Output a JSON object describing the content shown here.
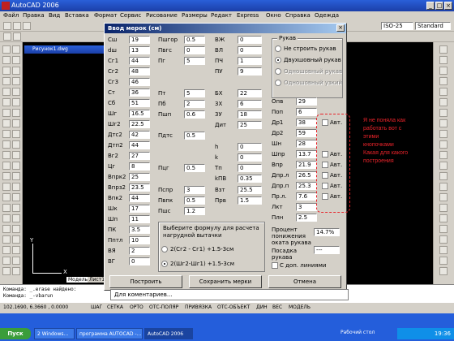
{
  "app": {
    "title": "AutoCAD 2006",
    "menu": [
      "Файл",
      "Правка",
      "Вид",
      "Вставка",
      "Формат",
      "Сервис",
      "Рисование",
      "Размеры",
      "Редакт",
      "Express",
      "Окно",
      "Справка",
      "Одежда"
    ],
    "layer_combo": "ISO-25",
    "style_combo": "Standard",
    "drawing_title": "Рисунок1.dwg",
    "tabs": [
      "Модель",
      "Лист1"
    ],
    "command_lines": [
      "Команда: _.erase найдено:",
      "Команда: _-vbarun"
    ],
    "coords": "102.1690, 6.3660 , 0.0000",
    "status": [
      "ШАГ",
      "СЕТКА",
      "ОРТО",
      "ОТС-ПОЛЯР",
      "ПРИВЯЗКА",
      "ОТС-ОБЪЕКТ",
      "ДИН",
      "ВЕС",
      "МОДЕЛЬ"
    ],
    "taskbar": {
      "start": "Пуск",
      "tasks": [
        "2 Windows...",
        "программа AUTOCAD -...",
        "AutoCAD 2006"
      ],
      "desktop": "Рабочий стол",
      "time": "19:36"
    }
  },
  "dialog": {
    "title": "Ввод мерок (см)",
    "col1": [
      {
        "label": "Сш",
        "value": "19"
      },
      {
        "label": "dш",
        "value": "13"
      },
      {
        "label": "Сг1",
        "value": "44"
      },
      {
        "label": "Сг2",
        "value": "48"
      },
      {
        "label": "Сг3",
        "value": "46"
      },
      {
        "label": "Ст",
        "value": "36"
      },
      {
        "label": "Сб",
        "value": "51"
      },
      {
        "label": "Шг",
        "value": "16.5"
      },
      {
        "label": "Шг2",
        "value": "22.5"
      },
      {
        "label": "Дтс2",
        "value": "42"
      },
      {
        "label": "Дтп2",
        "value": "44"
      },
      {
        "label": "Вг2",
        "value": "27"
      },
      {
        "label": "Цг",
        "value": "8"
      },
      {
        "label": "Впрк2",
        "value": "25"
      },
      {
        "label": "Впрз2",
        "value": "23.5"
      },
      {
        "label": "Впк2",
        "value": "44"
      },
      {
        "label": "Шк",
        "value": "17"
      },
      {
        "label": "Шп",
        "value": "11"
      },
      {
        "label": "ПК",
        "value": "3.5"
      },
      {
        "label": "Пптл",
        "value": "10"
      },
      {
        "label": "ВЯ",
        "value": "2"
      },
      {
        "label": "ВГ",
        "value": "0"
      }
    ],
    "col2": [
      {
        "label": "Пшгор",
        "value": "0.5"
      },
      {
        "label": "Пвгс",
        "value": "0"
      },
      {
        "label": "Пг",
        "value": "5"
      },
      {
        "label": "Пт",
        "value": "5"
      },
      {
        "label": "Пб",
        "value": "2"
      },
      {
        "label": "Пшп",
        "value": "0.6"
      },
      {
        "label": "Пдтс",
        "value": "0.5"
      },
      {
        "label": "Пцг",
        "value": "0.5"
      },
      {
        "label": "Пспр",
        "value": "3"
      },
      {
        "label": "Пвпк",
        "value": "0.5"
      },
      {
        "label": "Пшс",
        "value": "1.2"
      }
    ],
    "col3": [
      {
        "label": "ВЖ",
        "value": "0"
      },
      {
        "label": "ВЛ",
        "value": "0"
      },
      {
        "label": "ПЧ",
        "value": "1"
      },
      {
        "label": "ПУ",
        "value": "9"
      },
      {
        "label": "БХ",
        "value": "22"
      },
      {
        "label": "3Х",
        "value": "6"
      },
      {
        "label": "3У",
        "value": "18"
      },
      {
        "label": "Дит",
        "value": "25"
      },
      {
        "label": "h",
        "value": "0"
      },
      {
        "label": "k",
        "value": "0"
      },
      {
        "label": "Тп",
        "value": "0"
      },
      {
        "label": "kПВ",
        "value": "0.35"
      },
      {
        "label": "Взт",
        "value": "25.5"
      },
      {
        "label": "Прв",
        "value": "1.5"
      }
    ],
    "sleeve_group": {
      "title": "Рукав",
      "options": [
        {
          "label": "Не строить рукав",
          "selected": false,
          "enabled": true
        },
        {
          "label": "Двухшовный рукав",
          "selected": true,
          "enabled": true
        },
        {
          "label": "Одношовный рукав с налокотн",
          "selected": false,
          "enabled": false
        },
        {
          "label": "Одношовный узкий рукав",
          "selected": false,
          "enabled": false
        }
      ]
    },
    "col4": [
      {
        "label": "Опв",
        "value": "29",
        "check": false
      },
      {
        "label": "Поп",
        "value": "6",
        "check": false
      },
      {
        "label": "Др1",
        "value": "38",
        "check": true
      },
      {
        "label": "Др2",
        "value": "59",
        "check": false
      },
      {
        "label": "Шн",
        "value": "28",
        "check": false
      },
      {
        "label": "Шпр",
        "value": "13.7",
        "check": true
      },
      {
        "label": "Впр",
        "value": "21.9",
        "check": true
      },
      {
        "label": "Дпр.л",
        "value": "26.5",
        "check": true
      },
      {
        "label": "Дпр.п",
        "value": "25.3",
        "check": true
      },
      {
        "label": "Пр.л.",
        "value": "7.6",
        "check": true
      },
      {
        "label": "Лкт",
        "value": "3",
        "check": false
      },
      {
        "label": "Плн",
        "value": "2.5",
        "check": false
      }
    ],
    "auto_label": "Авт.",
    "percent": {
      "label": "Процент понижения оката рукава",
      "value": "14.7%"
    },
    "posadka": {
      "label": "Посадка рукава",
      "value": "---"
    },
    "extra_lines": "С доп. линиями",
    "formula_group": {
      "title": "Выберите формулу для расчета нагрудной вытачки",
      "options": [
        {
          "label": "2(Сг2 - Сг1) +1.5-3см",
          "selected": false
        },
        {
          "label": "2(Шг2-Шг1) +1.5-3см",
          "selected": true
        }
      ]
    },
    "buttons": {
      "build": "Построить",
      "save": "Сохранить мерки",
      "cancel": "Отмена"
    },
    "comment": "Для коментариев..."
  },
  "annotation": {
    "text": "Я не поняла как работать вот с этими кнопочками Какая для какого построения",
    "color": "#e8232a"
  }
}
